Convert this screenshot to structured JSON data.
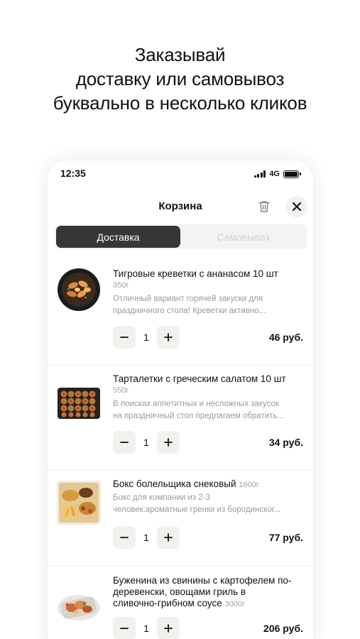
{
  "headline": {
    "line1": "Заказывай",
    "line2": "доставку или самовывоз",
    "line3": "буквально в несколько кликов"
  },
  "status": {
    "time": "12:35",
    "network": "4G"
  },
  "cart": {
    "title": "Корзина",
    "tabs": [
      {
        "label": "Доставка",
        "active": true
      },
      {
        "label": "Самовывоз",
        "active": false
      }
    ],
    "items": [
      {
        "name": "Тигровые креветки с ананасом 10 шт",
        "weight": "350г",
        "description_line1": "Отличный вариант горячей закуски для",
        "description_line2": "праздничного стола! Креветки активно...",
        "quantity": "1",
        "price": "46 руб."
      },
      {
        "name": "Тарталетки с греческим салатом 10 шт",
        "weight": "550г",
        "description_line1": "В поисках аппетитных и несложных закусок",
        "description_line2": "на праздничный стол предлагаем обратить...",
        "quantity": "1",
        "price": "34 руб."
      },
      {
        "name": "Бокс болельщика снековый",
        "weight": "1600г",
        "description_line1": "Бокс для компании из 2-3",
        "description_line2": "человек:ароматные гренки из бородинског...",
        "quantity": "1",
        "price": "77 руб."
      },
      {
        "name_line1": "Буженина из свинины с картофелем по-",
        "name_line2": "деревенски, овощами гриль в",
        "name_line3": "сливочно-грибном соусе",
        "weight": "3000г",
        "quantity": "1",
        "price": "206 руб."
      }
    ]
  },
  "icons": {
    "trash": "trash-icon",
    "close": "close-icon",
    "minus": "minus-icon",
    "plus": "plus-icon"
  }
}
